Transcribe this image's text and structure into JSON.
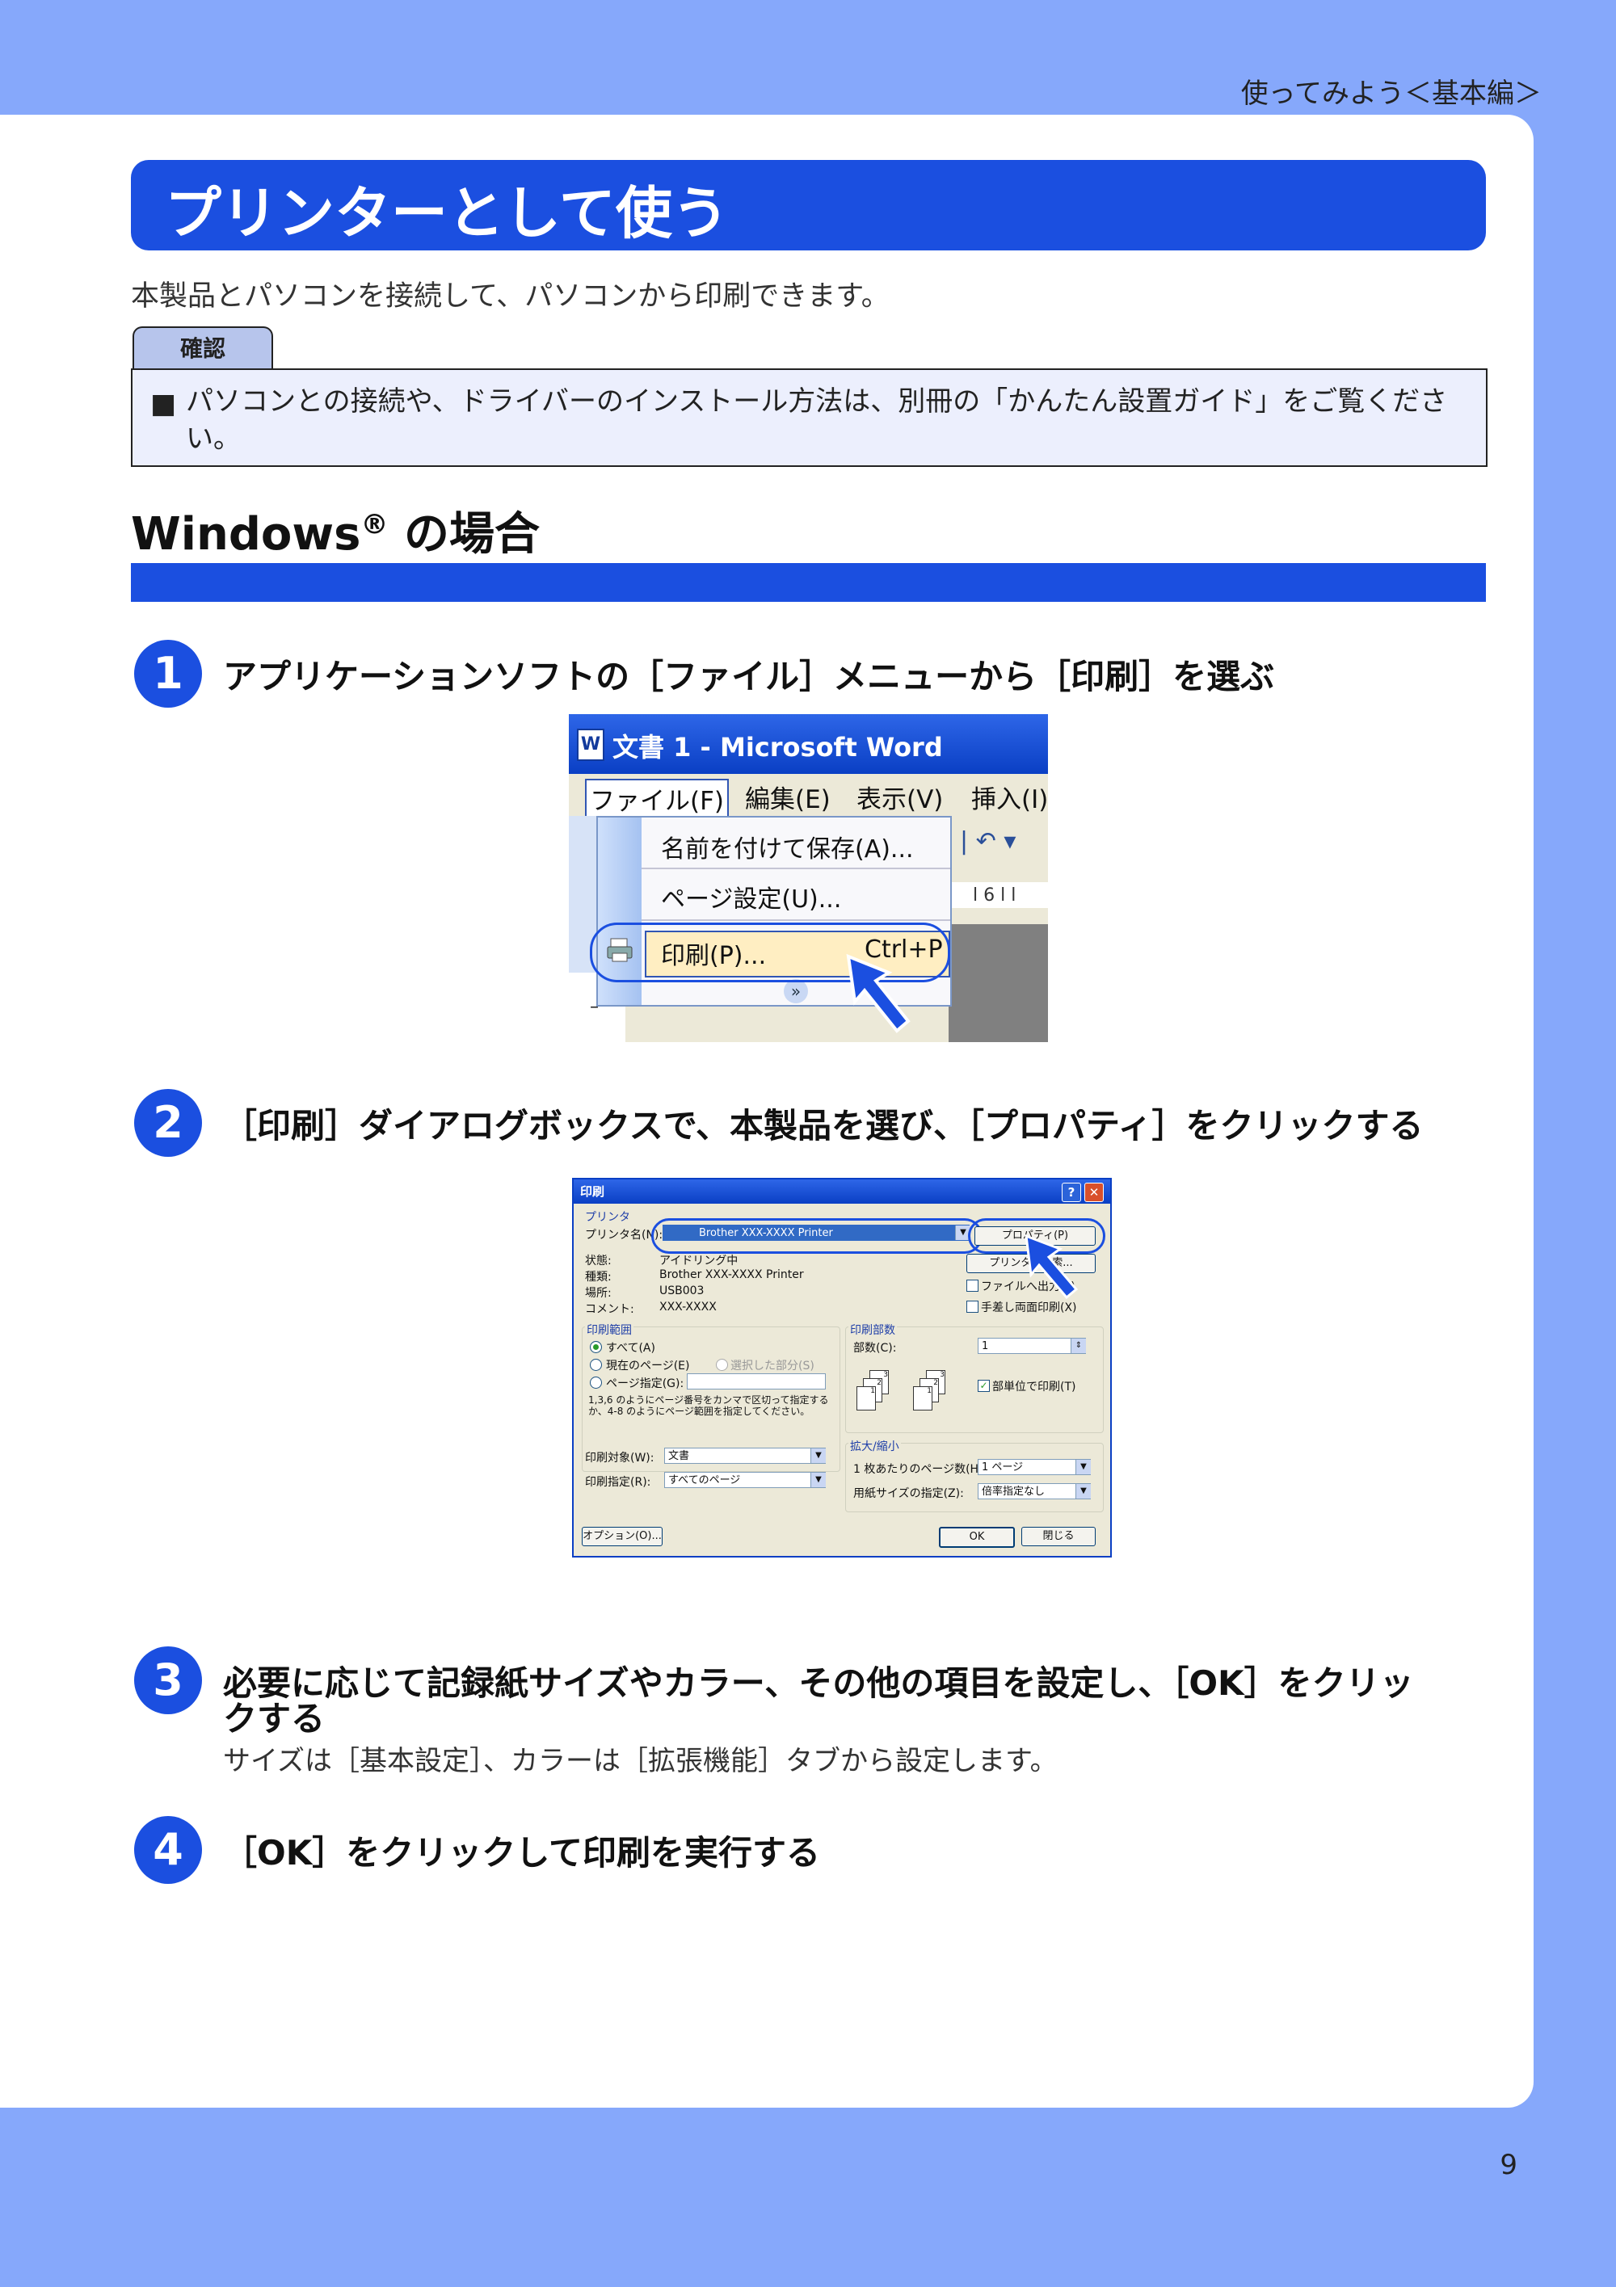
{
  "header": {
    "section_label": "使ってみよう＜基本編＞"
  },
  "title": "プリンターとして使う",
  "intro": "本製品とパソコンを接続して、パソコンから印刷できます。",
  "note": {
    "tab_label": "確認",
    "bullet": "■",
    "text": "パソコンとの接続や、ドライバーのインストール方法は、別冊の「かんたん設置ガイド」をご覧ください。"
  },
  "section": {
    "title": "Windows",
    "reg_mark": "®",
    "title_suffix": " の場合"
  },
  "steps": [
    {
      "num": "1",
      "text": "アプリケーションソフトの［ファイル］メニューから［印刷］を選ぶ"
    },
    {
      "num": "2",
      "text": "［印刷］ダイアログボックスで、本製品を選び、［プロパティ］をクリックする"
    },
    {
      "num": "3",
      "text": "必要に応じて記録紙サイズやカラー、その他の項目を設定し、［OK］をクリッ",
      "text2": "クする",
      "sub": "サイズは［基本設定］、カラーは［拡張機能］タブから設定します。"
    },
    {
      "num": "4",
      "text": "［OK］をクリックして印刷を実行する"
    }
  ],
  "word_screenshot": {
    "window_title": "文書 1 - Microsoft Word",
    "app_icon_letter": "W",
    "menu": [
      "ファイル(F)",
      "編集(E)",
      "表示(V)",
      "挿入(I)"
    ],
    "dropdown_items": [
      "名前を付けて保存(A)...",
      "ページ設定(U)...",
      "印刷(P)..."
    ],
    "print_shortcut": "Ctrl+P",
    "more_glyph": "»",
    "ruler_text": "l 6 l  l",
    "undo_glyph": "| ↶ ▾",
    "minus_glyph": "–"
  },
  "print_dialog": {
    "title": "印刷",
    "help_btn": "?",
    "close_btn": "✕",
    "printer_group": "プリンタ",
    "printer_name_label": "プリンタ名(N):",
    "printer_name": "Brother XXX-XXXX Printer",
    "status_label": "状態:",
    "status_value": "アイドリング中",
    "type_label": "種類:",
    "type_value": "Brother XXX-XXXX Printer",
    "where_label": "場所:",
    "where_value": "USB003",
    "comment_label": "コメント:",
    "comment_value": "XXX-XXXX",
    "properties_btn": "プロパティ(P)",
    "find_printer_btn": "プリンタの検索...",
    "print_to_file": "ファイルへ出力(L)",
    "manual_duplex": "手差し両面印刷(X)",
    "range_group": "印刷範囲",
    "range_all": "すべて(A)",
    "range_current": "現在のページ(E)",
    "range_selection": "選択した部分(S)",
    "range_pages": "ページ指定(G):",
    "range_hint": "1,3,6 のようにページ番号をカンマで区切って指定するか、4-8 のようにページ範囲を指定してください。",
    "copies_group": "印刷部数",
    "copies_label": "部数(C):",
    "copies_value": "1",
    "collate": "部単位で印刷(T)",
    "print_what_label": "印刷対象(W):",
    "print_what_value": "文書",
    "print_label": "印刷指定(R):",
    "print_value": "すべてのページ",
    "zoom_group": "拡大/縮小",
    "pages_per_sheet_label": "1 枚あたりのページ数(H):",
    "pages_per_sheet_value": "1 ページ",
    "scale_label": "用紙サイズの指定(Z):",
    "scale_value": "倍率指定なし",
    "options_btn": "オプション(O)...",
    "ok_btn": "OK",
    "close_label": "閉じる"
  },
  "page_number": "9"
}
